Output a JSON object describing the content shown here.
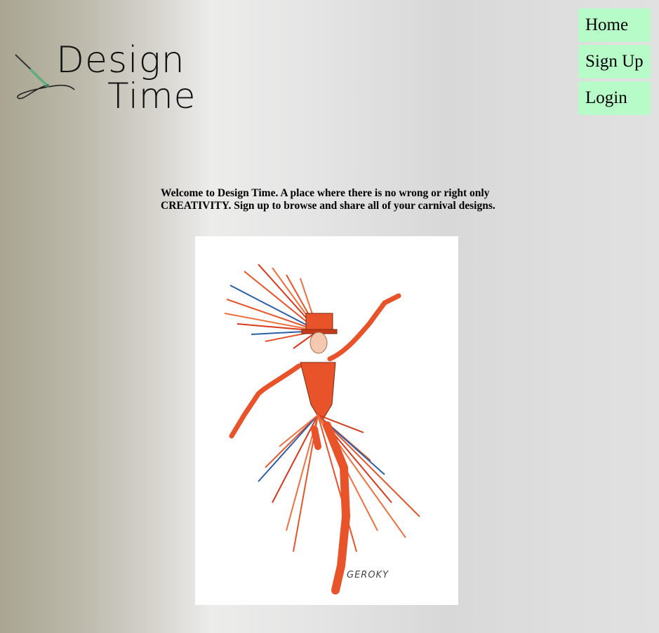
{
  "logo": {
    "line1": "Design",
    "line2": "Time",
    "icon": "needle-and-thread-icon"
  },
  "nav": {
    "home": "Home",
    "signup": "Sign Up",
    "login": "Login",
    "button_color": "#b6fbc8"
  },
  "main": {
    "welcome_text": "Welcome to Design Time. A place where there is no wrong or right only CREATIVITY. Sign up to browse and share all of your carnival designs.",
    "sketch": {
      "signature": "GEROKY"
    }
  }
}
